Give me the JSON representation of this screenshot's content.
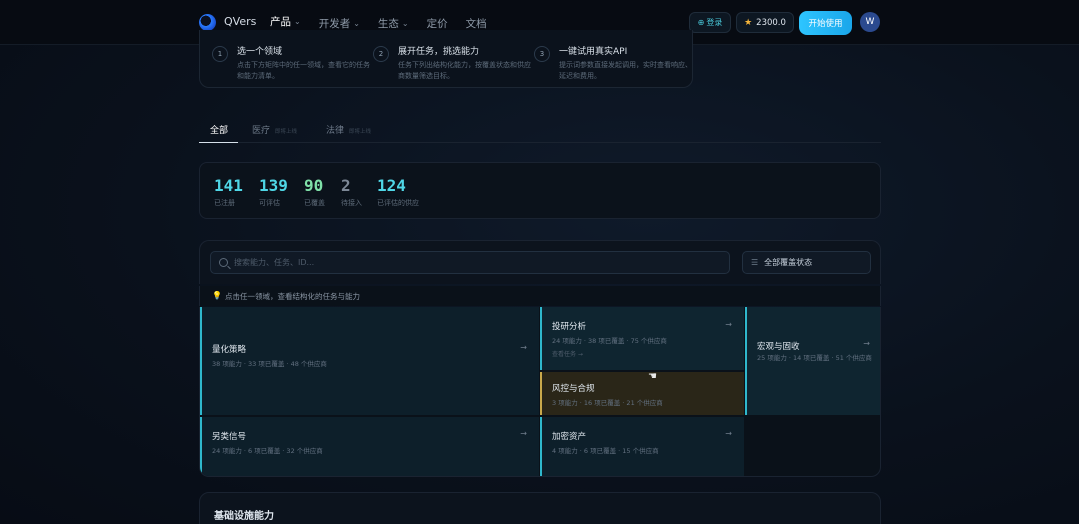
{
  "nav": {
    "brand": "QVers",
    "links": [
      {
        "label": "产品",
        "chevron": true,
        "active": true
      },
      {
        "label": "开发者",
        "chevron": true,
        "active": false
      },
      {
        "label": "生态",
        "chevron": true,
        "active": false
      },
      {
        "label": "定价",
        "chevron": false,
        "active": false
      },
      {
        "label": "文档",
        "chevron": false,
        "active": false
      }
    ],
    "login_label": "登录",
    "credits": "2300.0",
    "cta_label": "开始使用",
    "avatar_initial": "W"
  },
  "steps": [
    {
      "num": "1",
      "title": "选一个领域",
      "desc": "点击下方矩阵中的任一领域，查看它的任务和能力清单。"
    },
    {
      "num": "2",
      "title": "展开任务，挑选能力",
      "desc": "任务下列出结构化能力，按覆盖状态和供应商数量筛选目标。"
    },
    {
      "num": "3",
      "title": "一键试用真实API",
      "desc": "提示词参数直接发起调用，实时查看响应、延迟和费用。"
    }
  ],
  "tabs": [
    {
      "label": "全部",
      "badge": "",
      "active": true
    },
    {
      "label": "医疗",
      "badge": "即将上线",
      "active": false
    },
    {
      "label": "法律",
      "badge": "即将上线",
      "active": false
    }
  ],
  "stats": [
    {
      "value": "141",
      "label": "已注册",
      "color": "#4fd6e6"
    },
    {
      "value": "139",
      "label": "可评估",
      "color": "#4fd6e6"
    },
    {
      "value": "90",
      "label": "已覆盖",
      "color": "#7fe0a8"
    },
    {
      "value": "2",
      "label": "待接入",
      "color": "#7d8896"
    },
    {
      "value": "124",
      "label": "已评估的供应",
      "color": "#4fd6e6"
    }
  ],
  "search": {
    "placeholder": "搜索能力、任务、ID...",
    "filter_label": "全部覆盖状态"
  },
  "hint": {
    "icon": "💡",
    "text": "点击任一领域，查看结构化的任务与能力"
  },
  "tiles": [
    {
      "name": "量化策略",
      "meta": "38 项能力 · 33 项已覆盖 · 48 个供应商",
      "link": ""
    },
    {
      "name": "投研分析",
      "meta": "24 项能力 · 38 项已覆盖 · 75 个供应商",
      "link": "查看任务 →"
    },
    {
      "name": "风控与合规",
      "meta": "3 项能力 · 16 项已覆盖 · 21 个供应商",
      "link": ""
    },
    {
      "name": "宏观与固收",
      "meta": "25 项能力 · 14 项已覆盖 · 51 个供应商",
      "link": ""
    },
    {
      "name": "另类信号",
      "meta": "24 项能力 · 6 项已覆盖 · 32 个供应商",
      "link": ""
    },
    {
      "name": "加密资产",
      "meta": "4 项能力 · 6 项已覆盖 · 15 个供应商",
      "link": ""
    }
  ],
  "bottom_section": {
    "title": "基础设施能力"
  }
}
